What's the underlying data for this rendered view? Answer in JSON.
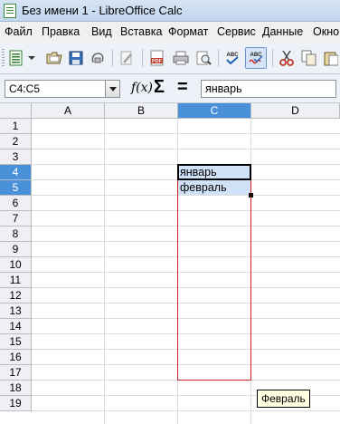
{
  "window": {
    "title": "Без имени 1 - LibreOffice Calc"
  },
  "menu": [
    "Файл",
    "Правка",
    "Вид",
    "Вставка",
    "Формат",
    "Сервис",
    "Данные",
    "Окно"
  ],
  "toolbar": {
    "buttons": [
      "new-document-icon",
      "open-folder-icon",
      "save-disk-icon",
      "email-icon",
      "edit-pencil-icon",
      "export-pdf-icon",
      "print-icon",
      "print-preview-icon",
      "spellcheck-icon",
      "autospellcheck-icon",
      "cut-scissors-icon",
      "copy-icon"
    ],
    "pdf_label": "PDF",
    "spell_label": "ABC",
    "autospell_label": "ABC"
  },
  "formula_bar": {
    "name_box": "C4:C5",
    "fx_label": "f(x)",
    "sum_symbol": "Σ",
    "equals_symbol": "=",
    "input": "январь"
  },
  "sheet": {
    "columns": [
      "A",
      "B",
      "C",
      "D"
    ],
    "selected_column": "C",
    "rows": [
      "1",
      "2",
      "3",
      "4",
      "5",
      "6",
      "7",
      "8",
      "9",
      "10",
      "11",
      "12",
      "13",
      "14",
      "15",
      "16",
      "17",
      "18",
      "19"
    ],
    "selected_rows": [
      "4",
      "5"
    ],
    "cells": {
      "C4": "январь",
      "C5": "февраль"
    },
    "autofill_tooltip": "Февраль"
  }
}
